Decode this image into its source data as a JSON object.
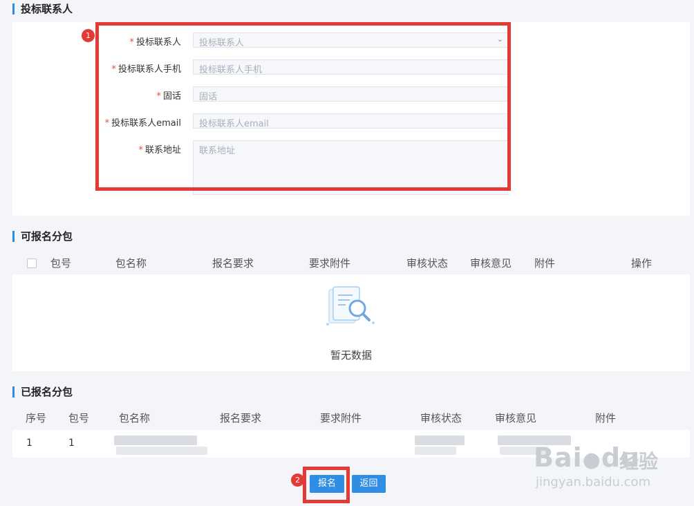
{
  "contact_section": {
    "title": "投标联系人",
    "fields": [
      {
        "label": "投标联系人",
        "required": "*",
        "placeholder": "投标联系人",
        "type": "select"
      },
      {
        "label": "投标联系人手机",
        "required": "*",
        "placeholder": "投标联系人手机",
        "type": "text"
      },
      {
        "label": "固话",
        "required": "*",
        "placeholder": "固话",
        "type": "text"
      },
      {
        "label": "投标联系人email",
        "required": "*",
        "placeholder": "投标联系人email",
        "type": "text"
      },
      {
        "label": "联系地址",
        "required": "*",
        "placeholder": "联系地址",
        "type": "textarea"
      }
    ]
  },
  "available_section": {
    "title": "可报名分包",
    "columns": [
      "包号",
      "包名称",
      "报名要求",
      "要求附件",
      "审核状态",
      "审核意见",
      "附件",
      "操作"
    ],
    "empty_text": "暂无数据",
    "empty_icon": "document-search-icon"
  },
  "registered_section": {
    "title": "已报名分包",
    "columns": [
      "序号",
      "包号",
      "包名称",
      "报名要求",
      "要求附件",
      "审核状态",
      "审核意见",
      "附件"
    ],
    "rows": [
      {
        "index": "1",
        "package_no": "1"
      }
    ]
  },
  "actions": {
    "register_label": "报名",
    "back_label": "返回"
  },
  "annotations": {
    "marker_1": "1",
    "marker_2": "2"
  },
  "watermark": {
    "brand": "Bai",
    "brand2": "du",
    "cn": "经验",
    "url": "jingyan.baidu.com"
  },
  "colors": {
    "accent": "#2f8de4",
    "highlight": "#e53935",
    "required": "#e64c3c"
  }
}
